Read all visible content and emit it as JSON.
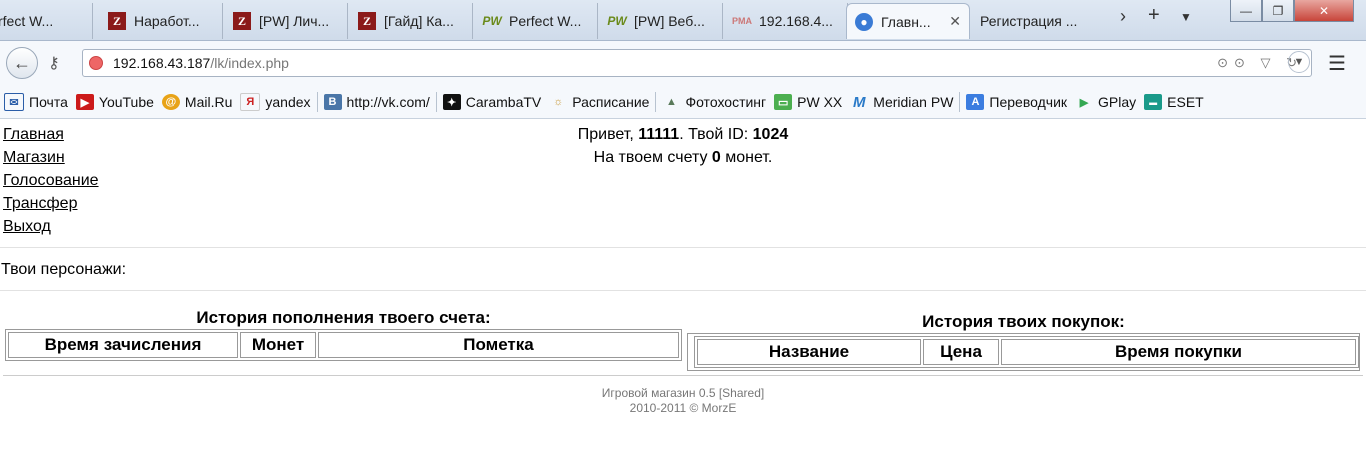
{
  "browser": {
    "tabs": [
      {
        "label": "rfect W...",
        "icon": "pw-icon",
        "active": false
      },
      {
        "label": "Наработ...",
        "icon": "z-icon",
        "active": false
      },
      {
        "label": "[PW] Лич...",
        "icon": "z-icon",
        "active": false
      },
      {
        "label": "[Гайд] Ка...",
        "icon": "z-icon",
        "active": false
      },
      {
        "label": "Perfect W...",
        "icon": "pw-icon",
        "active": false
      },
      {
        "label": "[PW] Веб...",
        "icon": "pw-icon",
        "active": false
      },
      {
        "label": "192.168.4...",
        "icon": "pma-icon",
        "active": false
      },
      {
        "label": "Главн...",
        "icon": "globe-icon",
        "active": true
      },
      {
        "label": "Регистрация ...",
        "icon": "",
        "active": false
      }
    ],
    "url_host": "192.168.43.187",
    "url_path": "/lk/index.php",
    "bookmarks": [
      {
        "label": "Почта",
        "icon": "mail-icon",
        "color": "#2a5da8"
      },
      {
        "label": "YouTube",
        "icon": "youtube-icon",
        "color": "#cc1a1a"
      },
      {
        "label": "Mail.Ru",
        "icon": "mailru-icon",
        "color": "#e8a317"
      },
      {
        "label": "yandex",
        "icon": "yandex-icon",
        "color": "#cc2222"
      },
      {
        "label": "http://vk.com/",
        "icon": "vk-icon",
        "color": "#4a76a8"
      },
      {
        "label": "CarambaTV",
        "icon": "caramba-icon",
        "color": "#111111"
      },
      {
        "label": "Расписание",
        "icon": "schedule-icon",
        "color": "#c99a3a"
      },
      {
        "label": "Фотохостинг",
        "icon": "photo-icon",
        "color": "#5a7a5a"
      },
      {
        "label": "PW XX",
        "icon": "chat-icon",
        "color": "#4caf50"
      },
      {
        "label": "Meridian PW",
        "icon": "meridian-icon",
        "color": "#2a7ac8"
      },
      {
        "label": "Переводчик",
        "icon": "translate-icon",
        "color": "#3b7de0"
      },
      {
        "label": "GPlay",
        "icon": "gplay-icon",
        "color": "#34a853"
      },
      {
        "label": "ESET",
        "icon": "eset-icon",
        "color": "#1a9a8a"
      }
    ]
  },
  "page": {
    "menu": [
      "Главная",
      "Магазин",
      "Голосование",
      "Трансфер",
      "Выход"
    ],
    "greeting_prefix": "Привет, ",
    "username": "11111",
    "id_label": ". Твой ID: ",
    "user_id": "1024",
    "balance_prefix": "На твоем счету ",
    "balance": "0",
    "balance_suffix": " монет.",
    "characters_label": "Твои персонажи:",
    "topup_history": {
      "title": "История пополнения твоего счета:",
      "columns": [
        "Время зачисления",
        "Монет",
        "Пометка"
      ]
    },
    "purchase_history": {
      "title": "История твоих покупок:",
      "columns": [
        "Название",
        "Цена",
        "Время покупки"
      ]
    },
    "footer": {
      "line1": "Игровой магазин 0.5 [Shared]",
      "line2": "2010-2011 © MorzE"
    }
  }
}
